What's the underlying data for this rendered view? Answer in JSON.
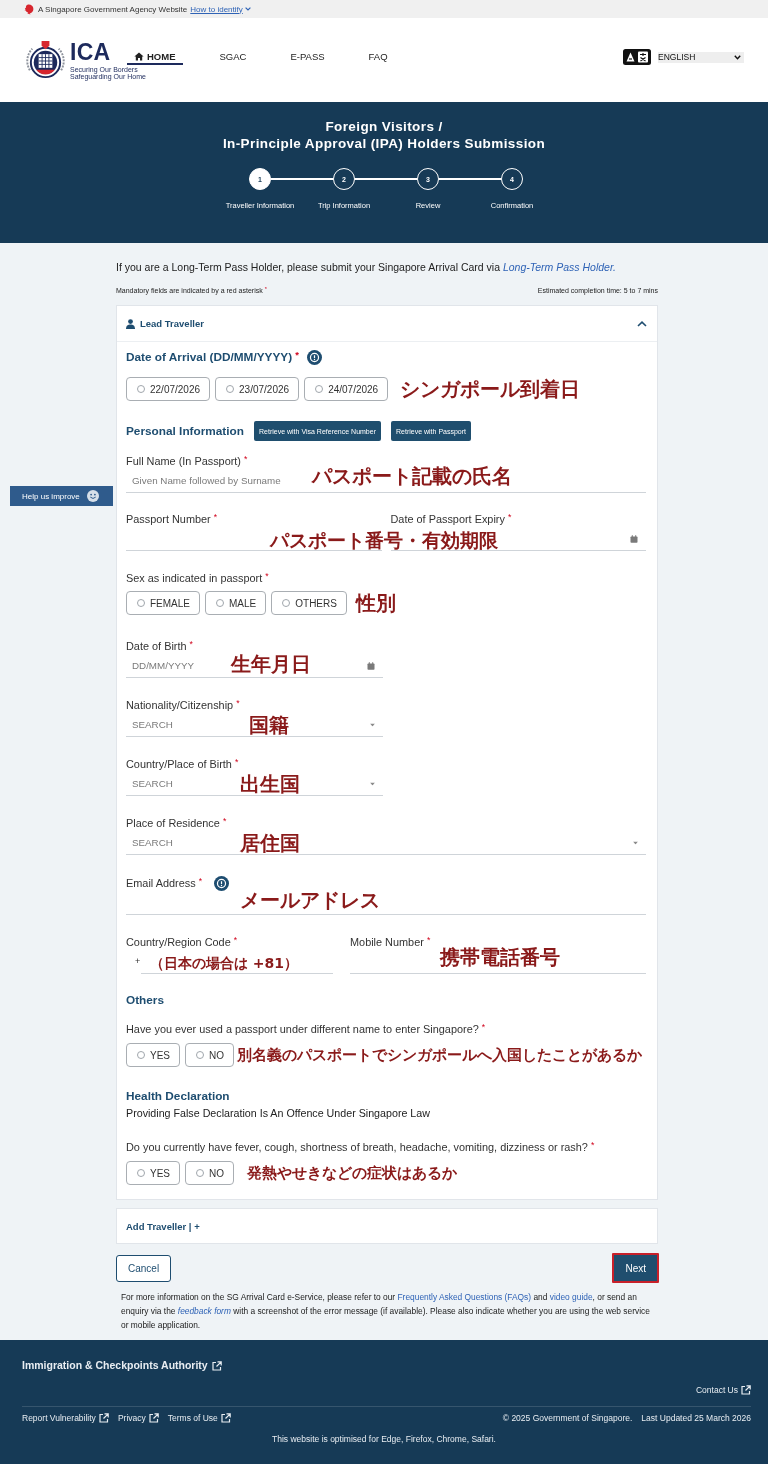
{
  "masthead": {
    "text": "A Singapore Government Agency Website",
    "link": "How to identify"
  },
  "header": {
    "logo": {
      "wordmark": "ICA",
      "tagline": [
        "Securing Our Borders",
        "Safeguarding Our Home"
      ]
    },
    "nav": [
      {
        "label": "HOME",
        "selected": true
      },
      {
        "label": "SGAC",
        "selected": false
      },
      {
        "label": "E-PASS",
        "selected": false
      },
      {
        "label": "FAQ",
        "selected": false
      }
    ],
    "language": "ENGLISH"
  },
  "banner": {
    "title": [
      "Foreign Visitors /",
      "In-Principle Approval (IPA) Holders Submission"
    ],
    "steps": [
      {
        "number": "1",
        "label": "Traveller Information",
        "selected": true
      },
      {
        "number": "2",
        "label": "Trip Information",
        "selected": false
      },
      {
        "number": "3",
        "label": "Review",
        "selected": false
      },
      {
        "number": "4",
        "label": "Confirmation",
        "selected": false
      }
    ]
  },
  "help_tab": "Help us improve",
  "notice": [
    {
      "kind": "text",
      "text": "If you are a Long-Term Pass Holder, please submit your Singapore Arrival Card via "
    },
    {
      "kind": "italic_link",
      "text": "Long-Term Pass Holder."
    }
  ],
  "mandatory_note": "Mandatory fields are indicated by a red asterisk $^{*}$",
  "completion_time": "Estimated completion time: 5 to 7 mins",
  "lead_traveller": {
    "title": "Lead Traveller",
    "expanded": true,
    "blocks": [
      {
        "kind": "heading_choice",
        "label": "Date of Arrival (DD/MM/YYYY) $^{*}$",
        "info": true,
        "options": [
          {
            "label": "22/07/2026",
            "selected": false
          },
          {
            "label": "23/07/2026",
            "selected": false
          },
          {
            "label": "24/07/2026",
            "selected": false
          }
        ],
        "annotation": "シンガポール到着日"
      },
      {
        "kind": "section",
        "title": "Personal Information",
        "buttons": [
          "Retrieve with Visa Reference Number",
          "Retrieve with Passport"
        ]
      },
      {
        "kind": "fields",
        "fields": [
          {
            "kind": "text",
            "label": "Full Name (In Passport) $^{*}$",
            "placeholder": "Given Name followed by Surname",
            "annotation": "パスポート記載の氏名"
          }
        ]
      },
      {
        "kind": "fields",
        "fields": [
          {
            "kind": "text",
            "label": "Passport Number $^{*}$"
          },
          {
            "kind": "date",
            "label": "Date of Passport Expiry $^{*}$"
          }
        ],
        "annotation": "パスポート番号・有効期限"
      },
      {
        "kind": "choice",
        "label": "Sex as indicated in passport $^{*}$",
        "options": [
          {
            "label": "FEMALE",
            "selected": false
          },
          {
            "label": "MALE",
            "selected": false
          },
          {
            "label": "OTHERS",
            "selected": false
          }
        ],
        "annotation": "性別"
      },
      {
        "kind": "fields",
        "fields": [
          {
            "kind": "date",
            "label": "Date of Birth $^{*}$",
            "placeholder": "DD/MM/YYYY",
            "annotation": "生年月日"
          }
        ]
      },
      {
        "kind": "fields",
        "fields": [
          {
            "kind": "select",
            "label": "Nationality/Citizenship $^{*}$",
            "placeholder": "SEARCH",
            "annotation": "国籍"
          }
        ]
      },
      {
        "kind": "fields",
        "fields": [
          {
            "kind": "select",
            "label": "Country/Place of Birth $^{*}$",
            "placeholder": "SEARCH",
            "annotation": "出生国"
          }
        ]
      },
      {
        "kind": "fields",
        "fields": [
          {
            "kind": "select",
            "label": "Place of Residence $^{*}$",
            "placeholder": "SEARCH",
            "annotation": "居住国"
          }
        ]
      },
      {
        "kind": "fields",
        "fields": [
          {
            "kind": "text",
            "label": "Email Address $^{*}$",
            "info": true,
            "annotation": "メールアドレス"
          }
        ]
      },
      {
        "kind": "fields",
        "fields": [
          {
            "kind": "code",
            "label": "Country/Region Code $^{*}$",
            "prefix": "+",
            "annotation": "（日本の場合は +81）"
          },
          {
            "kind": "text",
            "label": "Mobile Number $^{*}$",
            "annotation": "携帯電話番号"
          }
        ]
      },
      {
        "kind": "section",
        "title": "Others"
      },
      {
        "kind": "choice",
        "label": "Have you ever used a passport under different name to enter Singapore? $^{*}$",
        "options": [
          {
            "label": "YES",
            "selected": false
          },
          {
            "label": "NO",
            "selected": false
          }
        ],
        "annotation": "別名義のパスポートでシンガポールへ入国したことがあるか"
      },
      {
        "kind": "section",
        "title": "Health Declaration",
        "note": "Providing False Declaration Is An Offence Under Singapore Law"
      },
      {
        "kind": "choice",
        "label": "Do you currently have fever, cough, shortness of breath, headache, vomiting, dizziness or rash? $^{*}$",
        "options": [
          {
            "label": "YES",
            "selected": false
          },
          {
            "label": "NO",
            "selected": false
          }
        ],
        "annotation": "発熱やせきなどの症状はあるか"
      }
    ]
  },
  "add_traveller": "Add Traveller | +",
  "buttons": [
    {
      "kind": "secondary",
      "label": "Cancel",
      "highlighted": false
    },
    {
      "kind": "primary",
      "label": "Next",
      "highlighted": true
    }
  ],
  "help_text": [
    {
      "kind": "text",
      "text": "For more information on the SG Arrival Card e-Service, please refer to our "
    },
    {
      "kind": "link",
      "text": "Frequently Asked Questions (FAQs)"
    },
    {
      "kind": "text",
      "text": " and "
    },
    {
      "kind": "link",
      "text": "video guide"
    },
    {
      "kind": "text",
      "text": ", or send an enquiry via the "
    },
    {
      "kind": "italic_link",
      "text": "feedback form"
    },
    {
      "kind": "text",
      "text": " with a screenshot of the error message (if available). Please also indicate whether you are using the web service or mobile application."
    }
  ],
  "footer": {
    "agency": "Immigration & Checkpoints Authority",
    "contact": "Contact Us",
    "links": [
      "Report Vulnerability",
      "Privacy",
      "Terms of Use"
    ],
    "copyright": "© 2025 Government of Singapore.",
    "updated": "Last Updated 25 March 2026",
    "note": "This website is optimised for Edge, Firefox, Chrome, Safari."
  }
}
